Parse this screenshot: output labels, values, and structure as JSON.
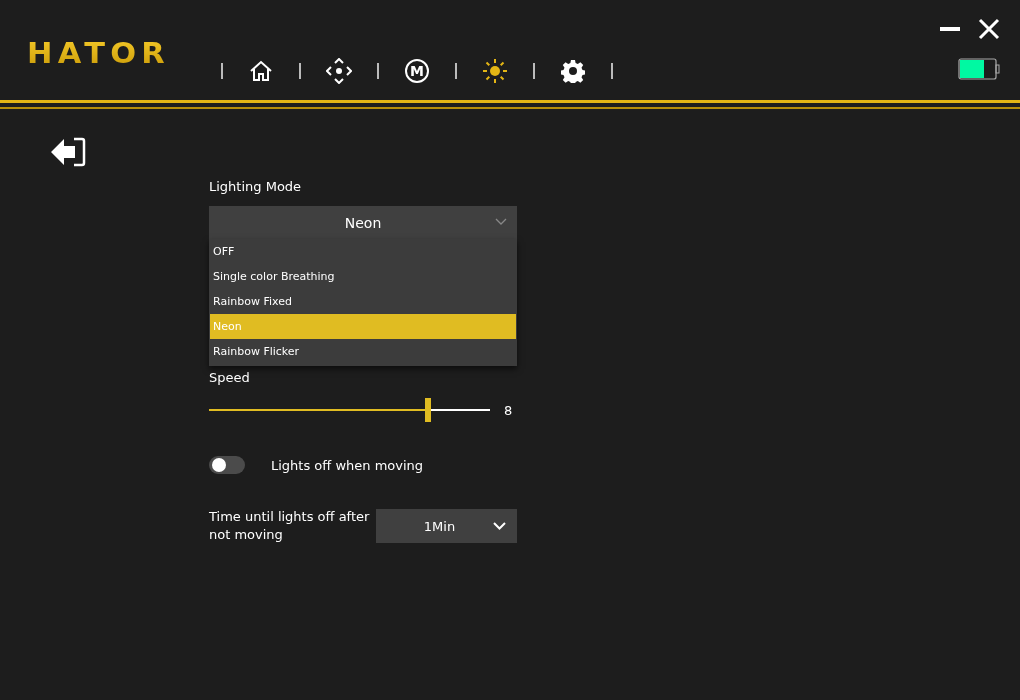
{
  "brand": {
    "logo": "HATOR"
  },
  "nav": [
    {
      "kind": "home",
      "selected": false
    },
    {
      "kind": "move",
      "selected": false
    },
    {
      "kind": "macro",
      "label": "M",
      "selected": false
    },
    {
      "kind": "light",
      "selected": true
    },
    {
      "kind": "settings",
      "selected": false
    }
  ],
  "lighting_mode": {
    "label": "Lighting Mode",
    "value": "Neon",
    "expanded": true,
    "options": [
      {
        "label": "OFF",
        "selected": false
      },
      {
        "label": "Single color Breathing",
        "selected": false
      },
      {
        "label": "Rainbow Fixed",
        "selected": false
      },
      {
        "label": "Neon",
        "selected": true
      },
      {
        "label": "Rainbow Flicker",
        "selected": false
      }
    ]
  },
  "speed": {
    "label": "Speed",
    "level": 0.78,
    "reading": "8"
  },
  "lights_off_when_moving": {
    "label": "Lights off when moving",
    "on": false
  },
  "idle_timeout": {
    "label": "Time until lights off after not moving",
    "value": "1Min"
  }
}
